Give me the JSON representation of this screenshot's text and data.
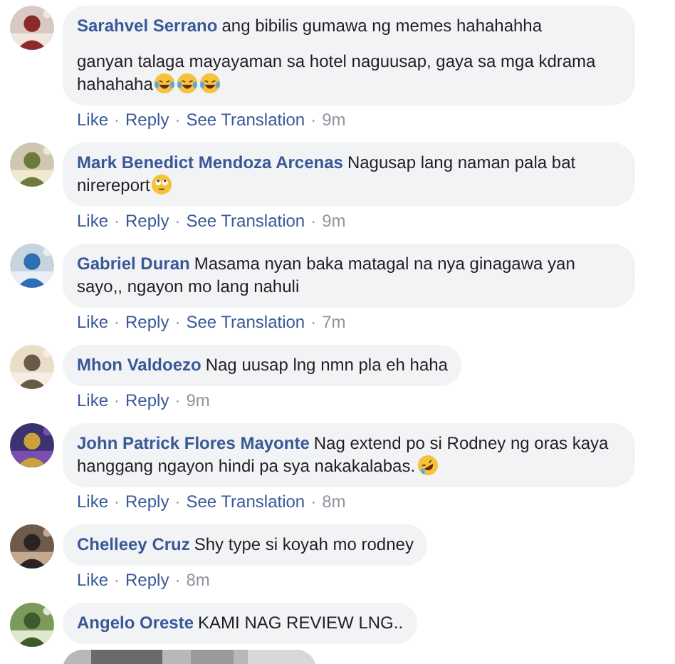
{
  "comments": [
    {
      "author": "Sarahvel Serrano",
      "paragraphs": [
        {
          "text": "ang bibilis gumawa ng memes hahahahha"
        },
        {
          "text": "ganyan talaga mayayaman sa hotel naguusap, gaya sa mga kdrama hahahaha",
          "icons": [
            {
              "kind": "tears-of-joy"
            },
            {
              "kind": "tears-of-joy"
            },
            {
              "kind": "tears-of-joy"
            }
          ]
        }
      ],
      "meta": [
        {
          "kind": "link",
          "text": "Like"
        },
        {
          "kind": "sep",
          "text": "·"
        },
        {
          "kind": "link",
          "text": "Reply"
        },
        {
          "kind": "sep",
          "text": "·"
        },
        {
          "kind": "link",
          "text": "See Translation"
        },
        {
          "kind": "sep",
          "text": "·"
        },
        {
          "kind": "time",
          "text": "9m"
        }
      ]
    },
    {
      "author": "Mark Benedict Mendoza Arcenas",
      "paragraphs": [
        {
          "text": "Nagusap lang naman pala bat nirereport",
          "icons": [
            {
              "kind": "rolling-eyes"
            }
          ]
        }
      ],
      "meta": [
        {
          "kind": "link",
          "text": "Like"
        },
        {
          "kind": "sep",
          "text": "·"
        },
        {
          "kind": "link",
          "text": "Reply"
        },
        {
          "kind": "sep",
          "text": "·"
        },
        {
          "kind": "link",
          "text": "See Translation"
        },
        {
          "kind": "sep",
          "text": "·"
        },
        {
          "kind": "time",
          "text": "9m"
        }
      ]
    },
    {
      "author": "Gabriel Duran",
      "paragraphs": [
        {
          "text": "Masama nyan baka matagal na nya ginagawa yan sayo,, ngayon mo lang nahuli"
        }
      ],
      "meta": [
        {
          "kind": "link",
          "text": "Like"
        },
        {
          "kind": "sep",
          "text": "·"
        },
        {
          "kind": "link",
          "text": "Reply"
        },
        {
          "kind": "sep",
          "text": "·"
        },
        {
          "kind": "link",
          "text": "See Translation"
        },
        {
          "kind": "sep",
          "text": "·"
        },
        {
          "kind": "time",
          "text": "7m"
        }
      ]
    },
    {
      "author": "Mhon Valdoezo",
      "paragraphs": [
        {
          "text": "Nag uusap lng nmn pla eh haha"
        }
      ],
      "meta": [
        {
          "kind": "link",
          "text": "Like"
        },
        {
          "kind": "sep",
          "text": "·"
        },
        {
          "kind": "link",
          "text": "Reply"
        },
        {
          "kind": "sep",
          "text": "·"
        },
        {
          "kind": "time",
          "text": "9m"
        }
      ]
    },
    {
      "author": "John Patrick Flores Mayonte",
      "paragraphs": [
        {
          "text": "Nag extend po si Rodney ng oras kaya hanggang ngayon hindi pa sya nakakalabas.",
          "icons": [
            {
              "kind": "rolling-laughing"
            }
          ]
        }
      ],
      "meta": [
        {
          "kind": "link",
          "text": "Like"
        },
        {
          "kind": "sep",
          "text": "·"
        },
        {
          "kind": "link",
          "text": "Reply"
        },
        {
          "kind": "sep",
          "text": "·"
        },
        {
          "kind": "link",
          "text": "See Translation"
        },
        {
          "kind": "sep",
          "text": "·"
        },
        {
          "kind": "time",
          "text": "8m"
        }
      ]
    },
    {
      "author": "Chelleey Cruz",
      "paragraphs": [
        {
          "text": "Shy type si koyah mo rodney"
        }
      ],
      "meta": [
        {
          "kind": "link",
          "text": "Like"
        },
        {
          "kind": "sep",
          "text": "·"
        },
        {
          "kind": "link",
          "text": "Reply"
        },
        {
          "kind": "sep",
          "text": "·"
        },
        {
          "kind": "time",
          "text": "8m"
        }
      ]
    },
    {
      "author": "Angelo Oreste",
      "paragraphs": [
        {
          "text": "KAMI NAG REVIEW LNG.."
        }
      ],
      "attachment": {
        "kind": "picture"
      }
    }
  ]
}
